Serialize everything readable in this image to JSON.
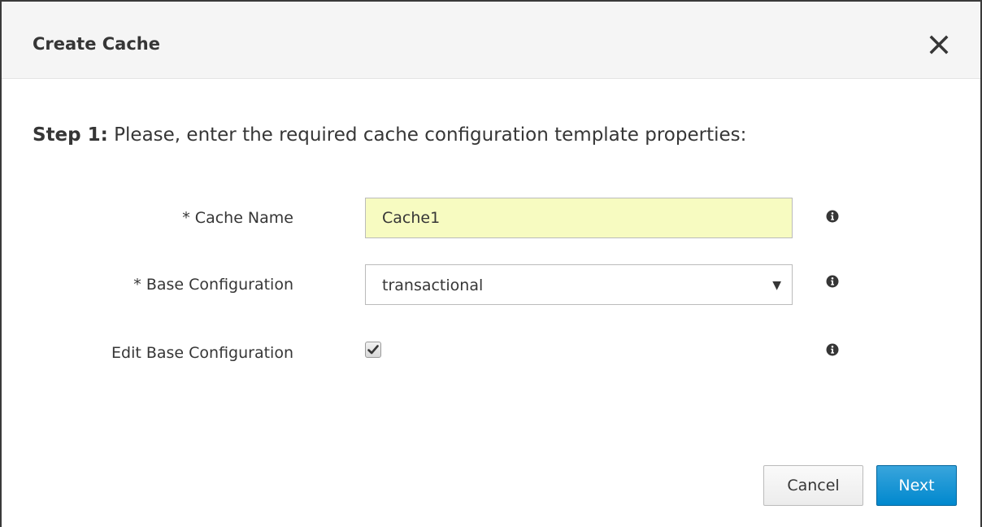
{
  "dialog": {
    "title": "Create Cache",
    "close_icon": "close-icon"
  },
  "step": {
    "number_label": "Step 1:",
    "instruction": "Please, enter the required cache configuration template properties:"
  },
  "form": {
    "cache_name": {
      "label": "* Cache Name",
      "value": "Cache1",
      "highlight_color": "#f7fbc1"
    },
    "base_configuration": {
      "label": "* Base Configuration",
      "selected": "transactional"
    },
    "edit_base_configuration": {
      "label": "Edit Base Configuration",
      "checked": true
    },
    "info_icon": "info-icon"
  },
  "footer": {
    "cancel_label": "Cancel",
    "next_label": "Next",
    "primary_color": "#0088ce"
  }
}
